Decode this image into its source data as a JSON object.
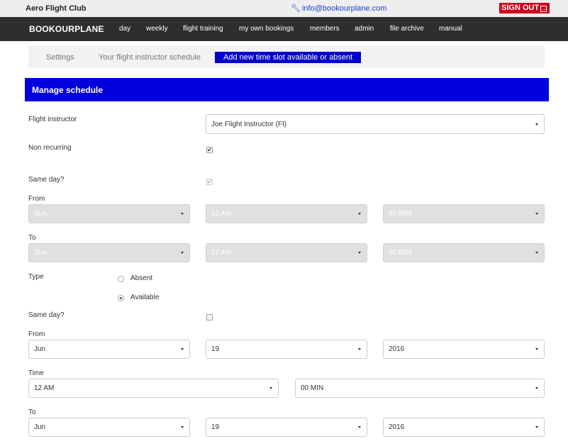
{
  "topbar": {
    "club_name": "Aero Flight Club",
    "email": "info@bookourplane.com",
    "signout_label": "SIGN OUT"
  },
  "navbar": {
    "brand": "BOOKOURPLANE",
    "items": [
      "day",
      "weekly",
      "flight training",
      "my own bookings",
      "members",
      "admin",
      "file archive",
      "manual"
    ]
  },
  "subnav": {
    "settings": "Settings",
    "schedule": "Your flight instructor schedule",
    "add_slot": "Add new time slot available or absent"
  },
  "panel": {
    "title": "Manage schedule"
  },
  "form": {
    "instructor_label": "Flight instructor",
    "instructor_value": "Joe Flight Instructor (FI)",
    "non_recurring_label": "Non recurring",
    "non_recurring_checked": true,
    "same_day_label": "Same day?",
    "same_day_checked": true,
    "from_label": "From",
    "to_label": "To",
    "recurring_from": {
      "day": "Sun.",
      "hour": "12 AM",
      "minute": "00 MIN"
    },
    "recurring_to": {
      "day": "Sun.",
      "hour": "12 AM",
      "minute": "00 MIN"
    },
    "type_label": "Type",
    "type_options": [
      "Absent",
      "Available"
    ],
    "type_selected": "Available",
    "same_day2_label": "Same day?",
    "same_day2_checked": false,
    "from2_label": "From",
    "from2": {
      "month": "Jun",
      "day": "19",
      "year": "2016"
    },
    "time_label": "Time",
    "time": {
      "hour": "12 AM",
      "minute": "00 MIN"
    },
    "to2_label": "To",
    "to2": {
      "month": "Jun",
      "day": "19",
      "year": "2016"
    }
  },
  "colors": {
    "accent_blue": "#0000dd",
    "signout_red": "#d0011b",
    "navbar_bg": "#2e2e2e"
  }
}
